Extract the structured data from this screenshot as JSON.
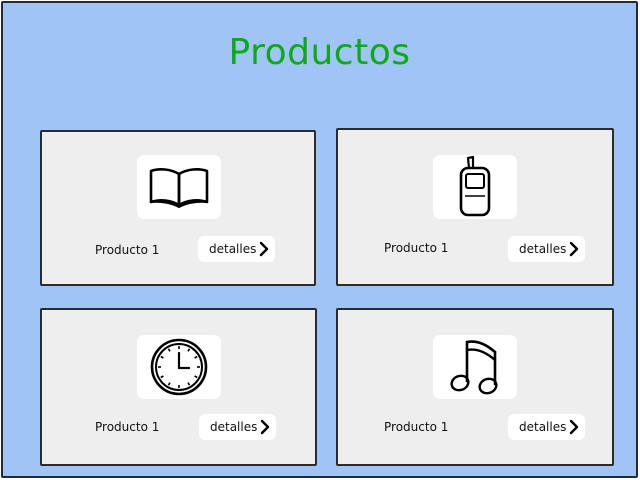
{
  "page": {
    "title": "Productos",
    "title_color": "#0bab16",
    "background_color": "#a1c4f6"
  },
  "products": [
    {
      "name": "Producto 1",
      "details_label": "detalles",
      "icon": "book-icon"
    },
    {
      "name": "Producto 1",
      "details_label": "detalles",
      "icon": "mobile-phone-icon"
    },
    {
      "name": "Producto 1",
      "details_label": "detalles",
      "icon": "clock-icon"
    },
    {
      "name": "Producto 1",
      "details_label": "detalles",
      "icon": "music-note-icon"
    }
  ]
}
